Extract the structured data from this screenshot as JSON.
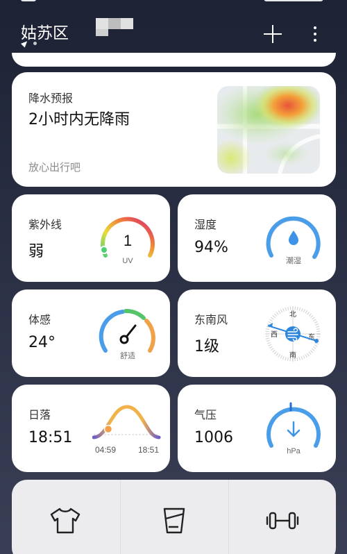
{
  "header": {
    "city": "姑苏区"
  },
  "precipitation": {
    "title": "降水预报",
    "headline": "2小时内无降雨",
    "advice": "放心出行吧"
  },
  "tiles": {
    "uv": {
      "title": "紫外线",
      "value": "弱",
      "index": "1",
      "unit": "UV"
    },
    "humidity": {
      "title": "湿度",
      "value": "94%",
      "label": "潮湿"
    },
    "feels_like": {
      "title": "体感",
      "value": "24°",
      "label": "舒适"
    },
    "wind": {
      "title": "东南风",
      "value": "1级",
      "north": "北",
      "south": "南",
      "east": "东",
      "west": "西"
    },
    "sunset": {
      "title": "日落",
      "value": "18:51",
      "sunrise_time": "04:59",
      "sunset_time": "18:51"
    },
    "pressure": {
      "title": "气压",
      "value": "1006",
      "unit": "hPa"
    }
  },
  "bottom": {
    "items": [
      {
        "icon": "tshirt-icon",
        "label": ""
      },
      {
        "icon": "cup-icon",
        "label": ""
      },
      {
        "icon": "dumbbell-icon",
        "label": ""
      }
    ]
  },
  "colors": {
    "accent_blue": "#4a9de8",
    "background_top": "#1d2234",
    "card": "#ffffff"
  }
}
